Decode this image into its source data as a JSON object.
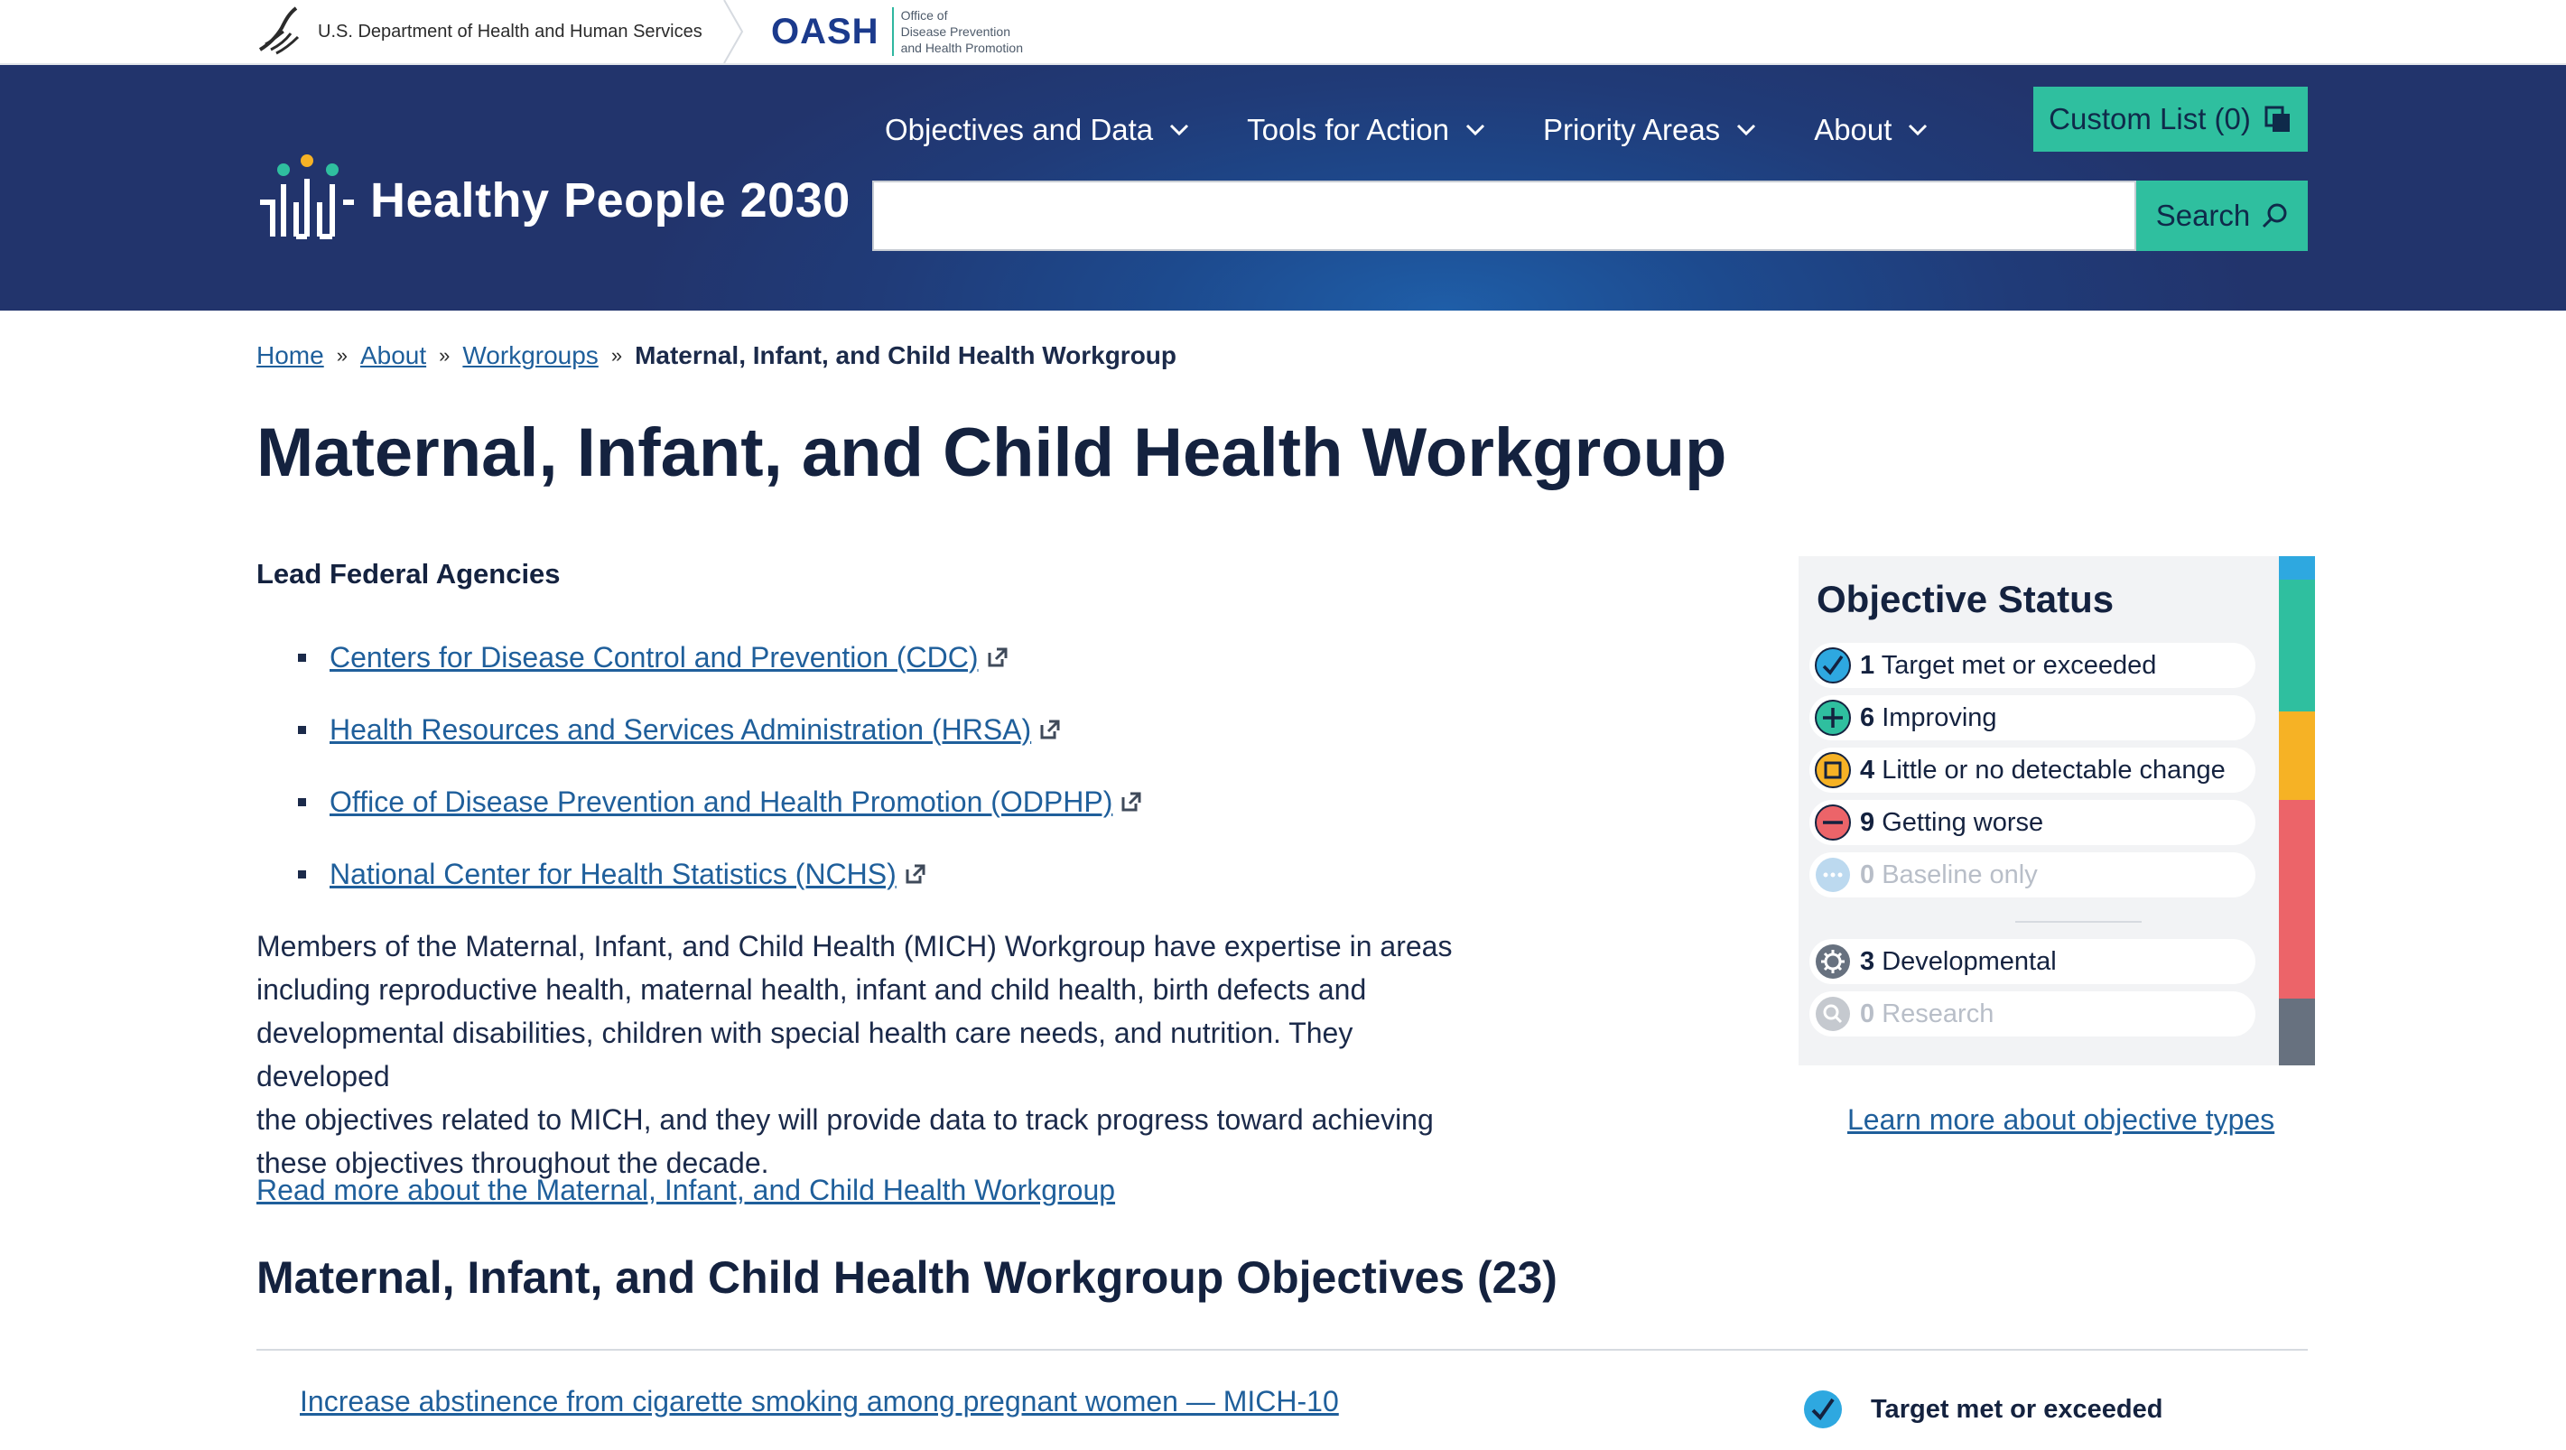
{
  "govbar": {
    "hhs_label": "U.S. Department of Health and Human Services",
    "oash_mark": "OASH",
    "oash_sub": [
      "Office of",
      "Disease Prevention",
      "and Health Promotion"
    ]
  },
  "header": {
    "site_title": "Healthy People 2030",
    "nav": [
      {
        "label": "Objectives and Data"
      },
      {
        "label": "Tools for Action"
      },
      {
        "label": "Priority Areas"
      },
      {
        "label": "About"
      }
    ],
    "custom_list_label": "Custom List (0)",
    "search": {
      "value": "",
      "placeholder": "",
      "button_label": "Search"
    }
  },
  "breadcrumb": {
    "items": [
      "Home",
      "About",
      "Workgroups"
    ],
    "current": "Maternal, Infant, and Child Health Workgroup"
  },
  "page": {
    "title": "Maternal, Infant, and Child Health Workgroup",
    "lead_heading": "Lead Federal Agencies",
    "agencies": [
      "Centers for Disease Control and Prevention (CDC)",
      "Health Resources and Services Administration (HRSA)",
      "Office of Disease Prevention and Health Promotion (ODPHP)",
      "National Center for Health Statistics (NCHS)"
    ],
    "description_lines": [
      "Members of the Maternal, Infant, and Child Health (MICH) Workgroup have expertise in areas",
      "including reproductive health, maternal health, infant and child health, birth defects and",
      "developmental disabilities, children with special health care needs, and nutrition. They developed",
      "the objectives related to MICH, and they will provide data to track progress toward achieving",
      "these objectives throughout the decade."
    ],
    "read_more": "Read more about the Maternal, Infant, and Child Health Workgroup",
    "objectives_heading": "Maternal, Infant, and Child Health Workgroup Objectives (23)",
    "objectives": [
      {
        "title": "Increase abstinence from cigarette smoking among pregnant women — MICH-10",
        "status": "Target met or exceeded"
      }
    ]
  },
  "status_panel": {
    "title": "Objective Status",
    "rows": [
      {
        "count": "1",
        "label": "Target met or exceeded",
        "icon": "check-icon",
        "color": "#2ea8e0"
      },
      {
        "count": "6",
        "label": "Improving",
        "icon": "plus-icon",
        "color": "#2fbf9f"
      },
      {
        "count": "4",
        "label": "Little or no detectable change",
        "icon": "square-icon",
        "color": "#f6b225"
      },
      {
        "count": "9",
        "label": "Getting worse",
        "icon": "minus-icon",
        "color": "#ec6469"
      },
      {
        "count": "0",
        "label": "Baseline only",
        "icon": "dots-icon",
        "color": "#bcd9ef"
      },
      {
        "count": "3",
        "label": "Developmental",
        "icon": "gear-icon",
        "color": "#67717f"
      },
      {
        "count": "0",
        "label": "Research",
        "icon": "research-icon",
        "color": "#c5c9cf"
      }
    ],
    "learn_more": "Learn more about objective types"
  }
}
